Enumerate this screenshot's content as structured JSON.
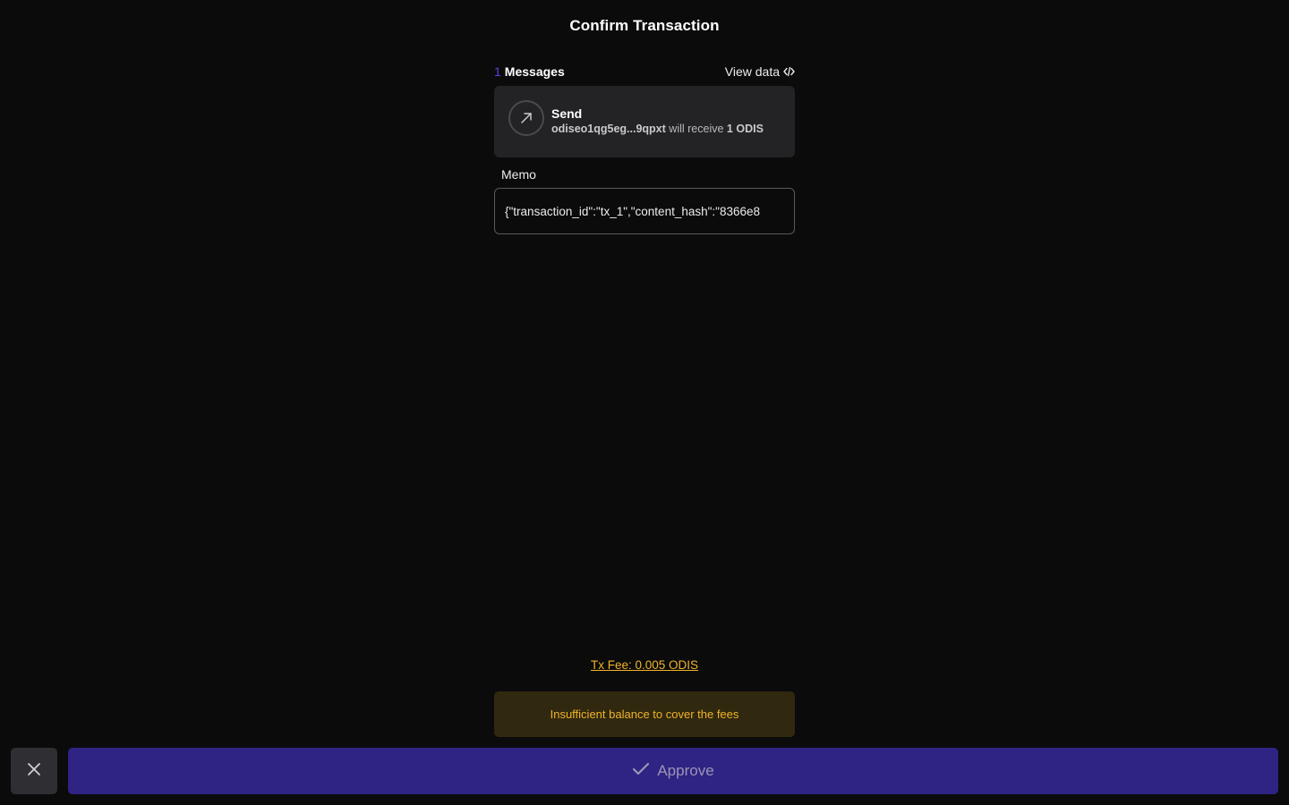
{
  "header": {
    "title": "Confirm Transaction"
  },
  "messages": {
    "count": "1",
    "label": "Messages",
    "view_data_label": "View data",
    "view_data_icon": "code-icon",
    "items": [
      {
        "icon": "arrow-up-right-icon",
        "title": "Send",
        "recipient": "odiseo1qg5eg...9qpxt",
        "middle_text": "will receive",
        "amount": "1 ODIS"
      }
    ]
  },
  "memo": {
    "label": "Memo",
    "value": "{\"transaction_id\":\"tx_1\",\"content_hash\":\"8366e8"
  },
  "fee": {
    "text": "Tx Fee: 0.005 ODIS"
  },
  "warning": {
    "text": "Insufficient balance to cover the fees"
  },
  "actions": {
    "close_icon": "close-icon",
    "approve_icon": "check-icon",
    "approve_label": "Approve"
  },
  "colors": {
    "background": "#0b0b0c",
    "accent": "#5b3fe0",
    "approve_bg": "#2f2383",
    "warning_text": "#f0b429",
    "warning_bg": "#30280f",
    "card_bg": "#232326"
  }
}
